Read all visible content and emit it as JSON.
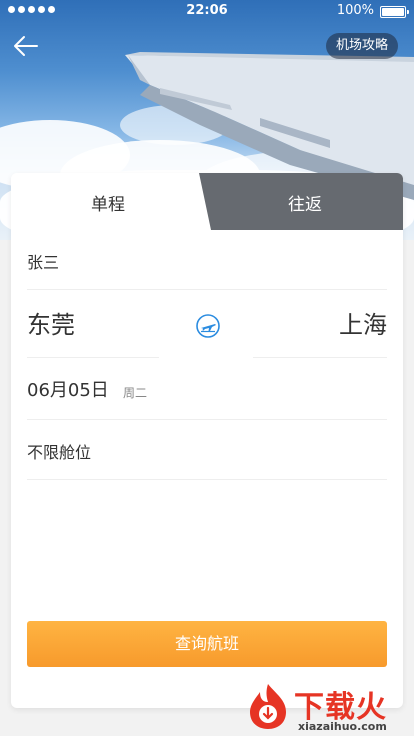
{
  "status_bar": {
    "time": "22:06",
    "battery": "100%"
  },
  "header": {
    "guide_label": "机场攻略"
  },
  "tabs": [
    {
      "label": "单程",
      "active": true
    },
    {
      "label": "往返",
      "active": false
    }
  ],
  "form": {
    "passenger": "张三",
    "from_city": "东莞",
    "to_city": "上海",
    "date": "06月05日",
    "weekday": "周二",
    "cabin": "不限舱位",
    "search_label": "查询航班"
  },
  "watermark": {
    "brand": "下载火",
    "url": "xiazaihuo.com"
  },
  "colors": {
    "accent": "#f79a2c",
    "icon_blue": "#2b8ce0",
    "tab_inactive": "#666a70"
  },
  "icons": {
    "back": "arrow-left-icon",
    "swap": "plane-swap-icon",
    "battery": "battery-icon",
    "signal": "signal-icon"
  }
}
